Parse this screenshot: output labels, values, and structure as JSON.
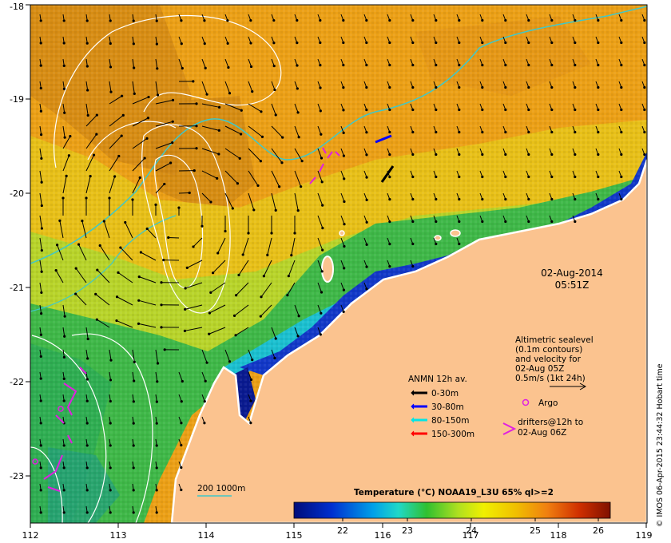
{
  "axes": {
    "lon_ticks": [
      "112",
      "113",
      "114",
      "115",
      "116",
      "117",
      "118",
      "119"
    ],
    "lat_ticks": [
      "-18",
      "-19",
      "-20",
      "-21",
      "-22",
      "-23"
    ]
  },
  "datetime": {
    "date": "02-Aug-2014",
    "time": "05:51Z"
  },
  "altimetry_note": {
    "lines": [
      "Altimetric sealevel",
      "(0.1m contours)",
      "and velocity for",
      "02-Aug 05Z",
      "0.5m/s (1kt 24h)"
    ]
  },
  "anmn_legend": {
    "title": "ANMN 12h av.",
    "items": [
      {
        "label": "0-30m",
        "color": "#000000"
      },
      {
        "label": "30-80m",
        "color": "#0000ff"
      },
      {
        "label": "80-150m",
        "color": "#00e5e5"
      },
      {
        "label": "150-300m",
        "color": "#ff0000"
      }
    ]
  },
  "argo": {
    "label": "Argo",
    "color": "#e020e0"
  },
  "drifters": {
    "line1": "drifters@12h to",
    "line2": "02-Aug 06Z",
    "color": "#e020e0"
  },
  "isobath": {
    "label": "200  1000m",
    "color": "#40c8c8"
  },
  "colorbar": {
    "title": "Temperature (°C) NOAA19_L3U 65% ql>=2",
    "ticks": [
      "22",
      "23",
      "24",
      "25",
      "26"
    ]
  },
  "credit": "© IMOS 06-Apr-2015 23:44:32 Hobart time",
  "colors": {
    "land": "#fbc38f",
    "sst_warm": "#f2a20e",
    "sst_cool": "#3fb848",
    "coast": "#ffffff"
  }
}
